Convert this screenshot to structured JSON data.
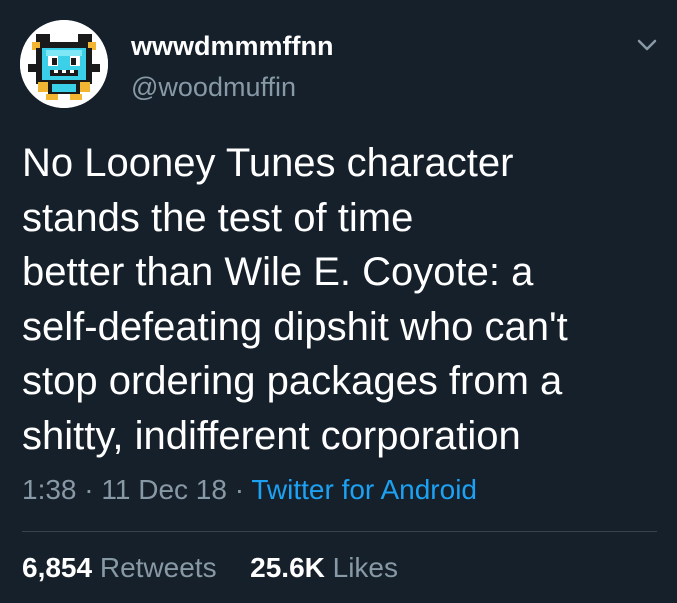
{
  "user": {
    "display_name": "wwwdmmmffnn",
    "handle": "@woodmuffin"
  },
  "tweet": {
    "lines": [
      "No Looney Tunes character",
      "stands the test of time",
      "better than Wile E. Coyote: a",
      "self-defeating dipshit who can't",
      "stop ordering packages from a",
      "shitty, indifferent corporation"
    ],
    "time": "1:38",
    "separator": "·",
    "date": "11 Dec 18",
    "source": "Twitter for Android"
  },
  "stats": {
    "retweets_count": "6,854",
    "retweets_label": "Retweets",
    "likes_count": "25.6K",
    "likes_label": "Likes"
  },
  "icons": {
    "menu": "chevron-down-icon",
    "avatar": "pixel-character-avatar"
  },
  "colors": {
    "background": "#15202b",
    "primary_text": "#ffffff",
    "secondary_text": "#8899a6",
    "link": "#1da1f2",
    "divider": "#38444d"
  }
}
